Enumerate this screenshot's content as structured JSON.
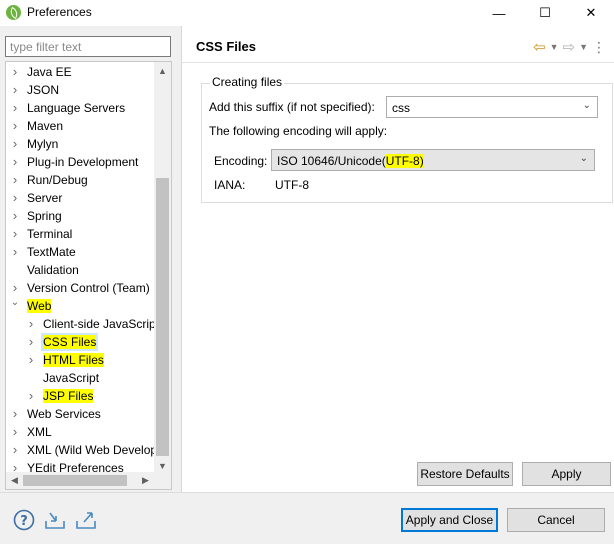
{
  "window": {
    "title": "Preferences",
    "minimize_glyph": "—",
    "maximize_glyph": "☐",
    "close_glyph": "✕"
  },
  "filter": {
    "placeholder": "type filter text",
    "value": ""
  },
  "tree": {
    "items": [
      {
        "label": "Java EE",
        "expanded": false,
        "highlight": false
      },
      {
        "label": "JSON",
        "expanded": false,
        "highlight": false
      },
      {
        "label": "Language Servers",
        "expanded": false,
        "highlight": false
      },
      {
        "label": "Maven",
        "expanded": false,
        "highlight": false
      },
      {
        "label": "Mylyn",
        "expanded": false,
        "highlight": false
      },
      {
        "label": "Plug-in Development",
        "expanded": false,
        "highlight": false
      },
      {
        "label": "Run/Debug",
        "expanded": false,
        "highlight": false
      },
      {
        "label": "Server",
        "expanded": false,
        "highlight": false
      },
      {
        "label": "Spring",
        "expanded": false,
        "highlight": false
      },
      {
        "label": "Terminal",
        "expanded": false,
        "highlight": false
      },
      {
        "label": "TextMate",
        "expanded": false,
        "highlight": false
      },
      {
        "label": "Validation",
        "expanded": null,
        "highlight": false
      },
      {
        "label": "Version Control (Team)",
        "expanded": false,
        "highlight": false
      },
      {
        "label": "Web",
        "expanded": true,
        "highlight": true
      },
      {
        "label": "Client-side JavaScript",
        "expanded": false,
        "highlight": false
      },
      {
        "label": "CSS Files",
        "expanded": false,
        "highlight": true,
        "selected": true
      },
      {
        "label": "HTML Files",
        "expanded": false,
        "highlight": true
      },
      {
        "label": "JavaScript",
        "expanded": null,
        "highlight": false
      },
      {
        "label": "JSP Files",
        "expanded": false,
        "highlight": true
      },
      {
        "label": "Web Services",
        "expanded": false,
        "highlight": false
      },
      {
        "label": "XML",
        "expanded": false,
        "highlight": false
      },
      {
        "label": "XML (Wild Web Developer)",
        "expanded": false,
        "highlight": false
      },
      {
        "label": "YEdit Preferences",
        "expanded": false,
        "highlight": false
      }
    ]
  },
  "page": {
    "title": "CSS Files",
    "group_title": "Creating files",
    "suffix_label": "Add this suffix (if not specified):",
    "suffix_value": "css",
    "encoding_note": "The following encoding will apply:",
    "encoding_label": "Encoding:",
    "encoding_value_prefix": "ISO 10646/Unicode(",
    "encoding_value_highlight": "UTF-8)",
    "iana_label": "IANA:",
    "iana_value": "UTF-8",
    "restore_defaults": "Restore Defaults",
    "apply": "Apply"
  },
  "footer": {
    "apply_and_close": "Apply and Close",
    "cancel": "Cancel"
  },
  "colors": {
    "highlight": "#ffff00",
    "selection": "#cce8ff",
    "default_button_border": "#0078d7"
  }
}
